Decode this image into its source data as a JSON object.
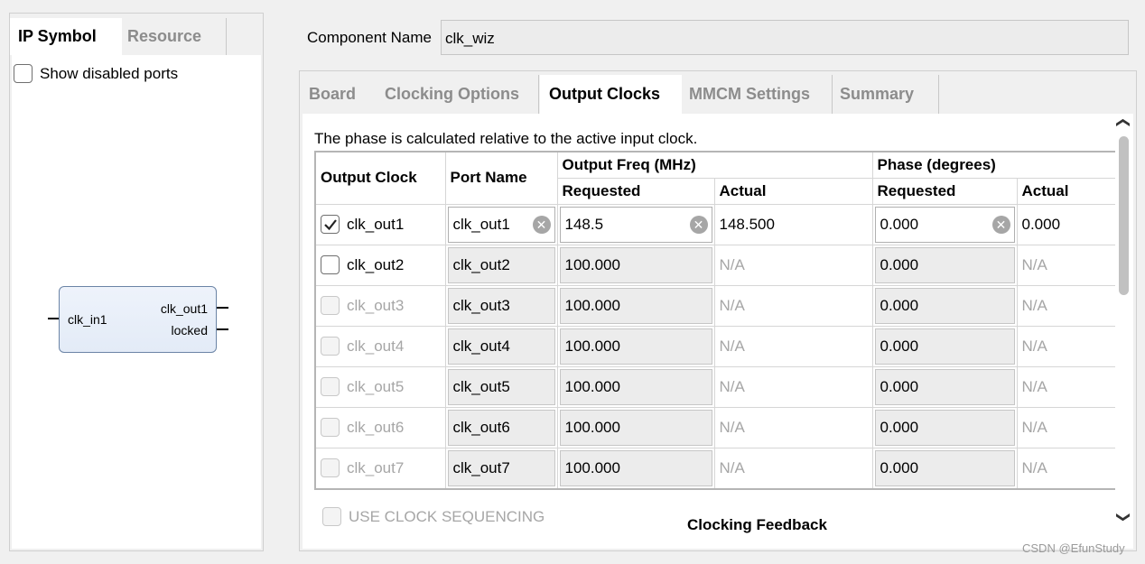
{
  "left_panel": {
    "tabs": [
      {
        "label": "IP Symbol",
        "active": true
      },
      {
        "label": "Resource",
        "active": false
      }
    ],
    "show_disabled_ports": "Show disabled ports",
    "symbol": {
      "input_ports": [
        "clk_in1"
      ],
      "output_ports": [
        "clk_out1",
        "locked"
      ]
    }
  },
  "component": {
    "label": "Component Name",
    "value": "clk_wiz"
  },
  "tabs": [
    {
      "label": "Board",
      "active": false
    },
    {
      "label": "Clocking Options",
      "active": false
    },
    {
      "label": "Output Clocks",
      "active": true
    },
    {
      "label": "MMCM Settings",
      "active": false
    },
    {
      "label": "Summary",
      "active": false
    }
  ],
  "output_clocks": {
    "note": "The phase is calculated relative to the active input clock.",
    "headers": {
      "output_clock": "Output Clock",
      "port_name": "Port Name",
      "output_freq": "Output Freq (MHz)",
      "phase": "Phase (degrees)",
      "requested": "Requested",
      "actual": "Actual"
    },
    "rows": [
      {
        "clock": "clk_out1",
        "checked": true,
        "enabled": true,
        "port": "clk_out1",
        "freq_requested": "148.5",
        "freq_actual": "148.500",
        "phase_requested": "0.000",
        "phase_actual": "0.000"
      },
      {
        "clock": "clk_out2",
        "checked": false,
        "enabled": true,
        "port": "clk_out2",
        "freq_requested": "100.000",
        "freq_actual": "N/A",
        "phase_requested": "0.000",
        "phase_actual": "N/A"
      },
      {
        "clock": "clk_out3",
        "checked": false,
        "enabled": false,
        "port": "clk_out3",
        "freq_requested": "100.000",
        "freq_actual": "N/A",
        "phase_requested": "0.000",
        "phase_actual": "N/A"
      },
      {
        "clock": "clk_out4",
        "checked": false,
        "enabled": false,
        "port": "clk_out4",
        "freq_requested": "100.000",
        "freq_actual": "N/A",
        "phase_requested": "0.000",
        "phase_actual": "N/A"
      },
      {
        "clock": "clk_out5",
        "checked": false,
        "enabled": false,
        "port": "clk_out5",
        "freq_requested": "100.000",
        "freq_actual": "N/A",
        "phase_requested": "0.000",
        "phase_actual": "N/A"
      },
      {
        "clock": "clk_out6",
        "checked": false,
        "enabled": false,
        "port": "clk_out6",
        "freq_requested": "100.000",
        "freq_actual": "N/A",
        "phase_requested": "0.000",
        "phase_actual": "N/A"
      },
      {
        "clock": "clk_out7",
        "checked": false,
        "enabled": false,
        "port": "clk_out7",
        "freq_requested": "100.000",
        "freq_actual": "N/A",
        "phase_requested": "0.000",
        "phase_actual": "N/A"
      }
    ],
    "use_clock_sequencing": "USE CLOCK SEQUENCING",
    "clocking_feedback": "Clocking Feedback"
  },
  "watermark": "CSDN @EfunStudy",
  "icons": {
    "clear": "clear-x-icon",
    "check": "check-icon",
    "scroll_up": "chevron-up-icon",
    "scroll_down": "chevron-down-icon",
    "scroll_left": "chevron-left-icon",
    "scroll_right": "chevron-right-icon"
  }
}
